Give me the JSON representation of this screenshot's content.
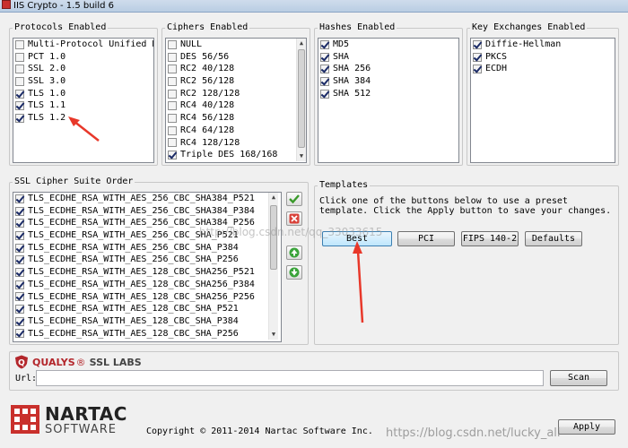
{
  "window": {
    "title": "IIS Crypto - 1.5 build 6"
  },
  "protocols": {
    "label": "Protocols Enabled",
    "items": [
      {
        "label": "Multi-Protocol Unified Hell",
        "checked": false
      },
      {
        "label": "PCT 1.0",
        "checked": false
      },
      {
        "label": "SSL 2.0",
        "checked": false
      },
      {
        "label": "SSL 3.0",
        "checked": false
      },
      {
        "label": "TLS 1.0",
        "checked": true
      },
      {
        "label": "TLS 1.1",
        "checked": true
      },
      {
        "label": "TLS 1.2",
        "checked": true
      }
    ]
  },
  "ciphers": {
    "label": "Ciphers Enabled",
    "items": [
      {
        "label": "NULL",
        "checked": false
      },
      {
        "label": "DES 56/56",
        "checked": false
      },
      {
        "label": "RC2 40/128",
        "checked": false
      },
      {
        "label": "RC2 56/128",
        "checked": false
      },
      {
        "label": "RC2 128/128",
        "checked": false
      },
      {
        "label": "RC4 40/128",
        "checked": false
      },
      {
        "label": "RC4 56/128",
        "checked": false
      },
      {
        "label": "RC4 64/128",
        "checked": false
      },
      {
        "label": "RC4 128/128",
        "checked": false
      },
      {
        "label": "Triple DES 168/168",
        "checked": true
      }
    ]
  },
  "hashes": {
    "label": "Hashes Enabled",
    "items": [
      {
        "label": "MD5",
        "checked": true
      },
      {
        "label": "SHA",
        "checked": true
      },
      {
        "label": "SHA 256",
        "checked": true
      },
      {
        "label": "SHA 384",
        "checked": true
      },
      {
        "label": "SHA 512",
        "checked": true
      }
    ]
  },
  "key_exchanges": {
    "label": "Key Exchanges Enabled",
    "items": [
      {
        "label": "Diffie-Hellman",
        "checked": true
      },
      {
        "label": "PKCS",
        "checked": true
      },
      {
        "label": "ECDH",
        "checked": true
      }
    ]
  },
  "suites": {
    "label": "SSL Cipher Suite Order",
    "items": [
      {
        "label": "TLS_ECDHE_RSA_WITH_AES_256_CBC_SHA384_P521",
        "checked": true
      },
      {
        "label": "TLS_ECDHE_RSA_WITH_AES_256_CBC_SHA384_P384",
        "checked": true
      },
      {
        "label": "TLS_ECDHE_RSA_WITH_AES_256_CBC_SHA384_P256",
        "checked": true
      },
      {
        "label": "TLS_ECDHE_RSA_WITH_AES_256_CBC_SHA_P521",
        "checked": true
      },
      {
        "label": "TLS_ECDHE_RSA_WITH_AES_256_CBC_SHA_P384",
        "checked": true
      },
      {
        "label": "TLS_ECDHE_RSA_WITH_AES_256_CBC_SHA_P256",
        "checked": true
      },
      {
        "label": "TLS_ECDHE_RSA_WITH_AES_128_CBC_SHA256_P521",
        "checked": true
      },
      {
        "label": "TLS_ECDHE_RSA_WITH_AES_128_CBC_SHA256_P384",
        "checked": true
      },
      {
        "label": "TLS_ECDHE_RSA_WITH_AES_128_CBC_SHA256_P256",
        "checked": true
      },
      {
        "label": "TLS_ECDHE_RSA_WITH_AES_128_CBC_SHA_P521",
        "checked": true
      },
      {
        "label": "TLS_ECDHE_RSA_WITH_AES_128_CBC_SHA_P384",
        "checked": true
      },
      {
        "label": "TLS_ECDHE_RSA_WITH_AES_128_CBC_SHA_P256",
        "checked": true
      }
    ]
  },
  "templates": {
    "label": "Templates",
    "description": "Click one of the buttons below to use a preset template. Click the Apply button to save your changes.",
    "buttons": [
      "Best",
      "PCI",
      "FIPS 140-2",
      "Defaults"
    ]
  },
  "ssllabs": {
    "brand": "QUALYS",
    "product": "SSL LABS",
    "url_label": "Url:",
    "url_value": "",
    "scan_label": "Scan"
  },
  "footer": {
    "logo_top": "NARTAC",
    "logo_bottom": "SOFTWARE",
    "copyright": "Copyright © 2011-2014 Nartac Software Inc.",
    "apply_label": "Apply"
  },
  "watermarks": {
    "middle": "http://blog.csdn.net/qq_33033615",
    "bottom": "https://blog.csdn.net/lucky_ali"
  },
  "colors": {
    "arrow": "#e8382a",
    "logo_red": "#c9302c",
    "qualys_red": "#b3262b"
  }
}
